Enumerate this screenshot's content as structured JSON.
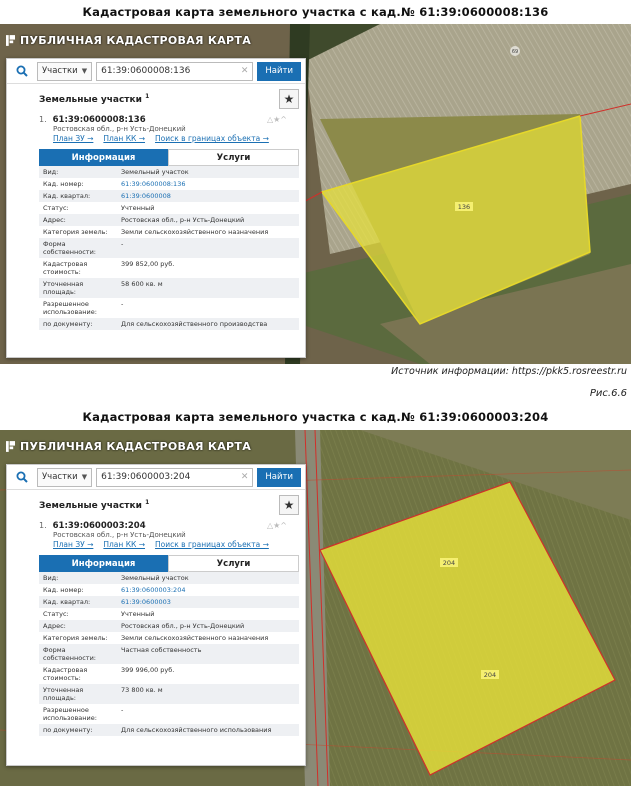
{
  "figures": [
    {
      "caption": "Кадастровая карта земельного участка с кад.№ 61:39:0600008:136",
      "brand": "ПУБЛИЧНАЯ КАДАСТРОВАЯ КАРТА",
      "search": {
        "scope": "Участки",
        "query": "61:39:0600008:136",
        "button": "Найти"
      },
      "section_title": "Земельные участки",
      "section_count": "1",
      "result_index": "1.",
      "result_cad": "61:39:0600008:136",
      "result_address": "Ростовская обл., р-н Усть-Донецкий",
      "links": [
        "План ЗУ →",
        "План КК →",
        "Поиск в границах объекта →"
      ],
      "tabs": [
        "Информация",
        "Услуги"
      ],
      "rows": [
        {
          "k": "Вид:",
          "v": "Земельный участок"
        },
        {
          "k": "Кад. номер:",
          "v": "61:39:0600008:136"
        },
        {
          "k": "Кад. квартал:",
          "v": "61:39:0600008"
        },
        {
          "k": "Статус:",
          "v": "Учтенный"
        },
        {
          "k": "Адрес:",
          "v": "Ростовская обл., р-н Усть-Донецкий"
        },
        {
          "k": "Категория земель:",
          "v": "Земли сельскохозяйственного назначения"
        },
        {
          "k": "Форма собственности:",
          "v": "-"
        },
        {
          "k": "Кадастровая стоимость:",
          "v": "399 852,00 руб."
        },
        {
          "k": "Уточненная площадь:",
          "v": "58 600 кв. м"
        },
        {
          "k": "Разрешенное использование:",
          "v": "-"
        },
        {
          "k": "по документу:",
          "v": "Для сельскохозяйственного производства"
        }
      ],
      "parcel_label": "136",
      "source": "Источник информации: https://pkk5.rosreestr.ru",
      "fig_number": "Рис.6.6"
    },
    {
      "caption": "Кадастровая карта земельного участка с кад.№ 61:39:0600003:204",
      "brand": "ПУБЛИЧНАЯ КАДАСТРОВАЯ КАРТА",
      "search": {
        "scope": "Участки",
        "query": "61:39:0600003:204",
        "button": "Найти"
      },
      "section_title": "Земельные участки",
      "section_count": "1",
      "result_index": "1.",
      "result_cad": "61:39:0600003:204",
      "result_address": "Ростовская обл., р-н Усть-Донецкий",
      "links": [
        "План ЗУ →",
        "План КК →",
        "Поиск в границах объекта →"
      ],
      "tabs": [
        "Информация",
        "Услуги"
      ],
      "rows": [
        {
          "k": "Вид:",
          "v": "Земельный участок"
        },
        {
          "k": "Кад. номер:",
          "v": "61:39:0600003:204"
        },
        {
          "k": "Кад. квартал:",
          "v": "61:39:0600003"
        },
        {
          "k": "Статус:",
          "v": "Учтенный"
        },
        {
          "k": "Адрес:",
          "v": "Ростовская обл., р-н Усть-Донецкий"
        },
        {
          "k": "Категория земель:",
          "v": "Земли сельскохозяйственного назначения"
        },
        {
          "k": "Форма собственности:",
          "v": "Частная собственность"
        },
        {
          "k": "Кадастровая стоимость:",
          "v": "399 996,00 руб."
        },
        {
          "k": "Уточненная площадь:",
          "v": "73 800 кв. м"
        },
        {
          "k": "Разрешенное использование:",
          "v": "-"
        },
        {
          "k": "по документу:",
          "v": "Для сельскохозяйственного использования"
        }
      ],
      "parcel_label": "204",
      "parcel_label_2": "204"
    }
  ],
  "colors": {
    "accent": "#1a6fb3",
    "parcel_fill": "#e8e23a",
    "boundary": "#d0302a"
  }
}
